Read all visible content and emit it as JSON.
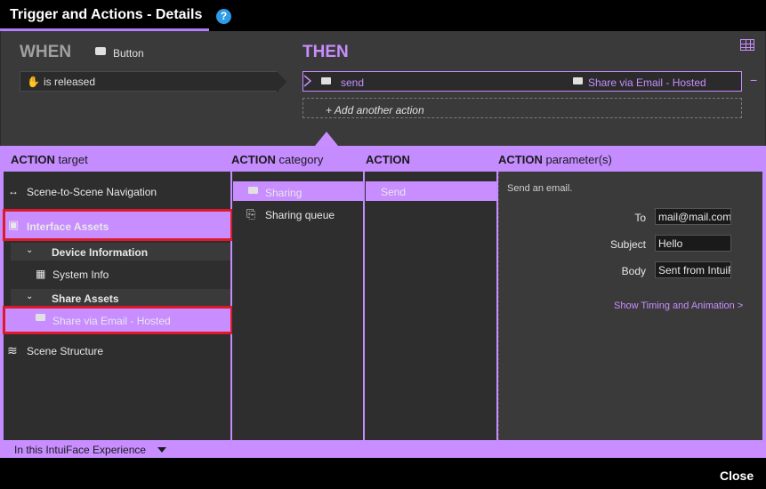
{
  "window": {
    "title": "Trigger and Actions - Details",
    "help": "?"
  },
  "when": {
    "title": "WHEN",
    "source": "Button",
    "trigger": "is released"
  },
  "then": {
    "title": "THEN",
    "action_name": "send",
    "action_target": "Share via Email - Hosted",
    "remove": "−",
    "add_action": "Add another action",
    "add_plus": "+"
  },
  "headers": {
    "target_bold": "ACTION",
    "target_rest": "target",
    "category_bold": "ACTION",
    "category_rest": "category",
    "action_bold": "ACTION",
    "params_bold": "ACTION",
    "params_rest": "parameter(s)"
  },
  "targets": {
    "scene_nav": "Scene-to-Scene Navigation",
    "interface_assets": "Interface Assets",
    "device_info": "Device Information",
    "system_info": "System Info",
    "share_assets": "Share Assets",
    "share_email": "Share via Email - Hosted",
    "scene_structure": "Scene Structure"
  },
  "categories": [
    "Sharing",
    "Sharing queue"
  ],
  "actions": [
    "Send"
  ],
  "params": {
    "description": "Send an email.",
    "to_label": "To",
    "to_value": "mail@mail.com",
    "subject_label": "Subject",
    "subject_value": "Hello",
    "body_label": "Body",
    "body_value": "Sent from IntuiFace",
    "timing_link": "Show Timing and Animation",
    "timing_chevron": ">"
  },
  "footer": {
    "scope": "In this IntuiFace Experience",
    "close": "Close"
  },
  "colors": {
    "accent": "#c88dff",
    "highlight": "#e0192a",
    "help": "#2e9be6"
  }
}
